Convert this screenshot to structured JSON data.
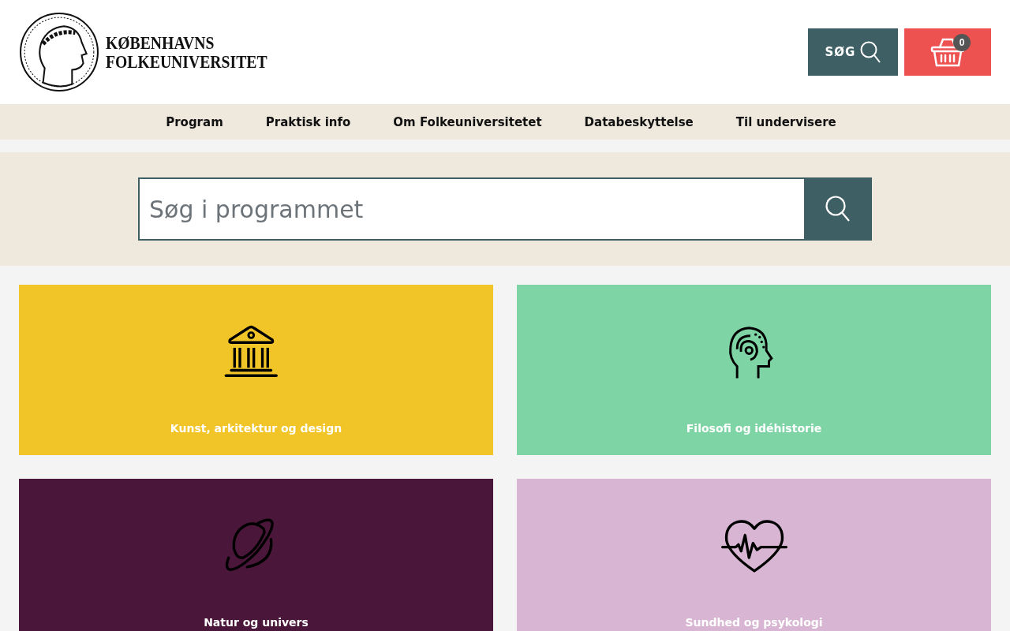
{
  "logo": {
    "line_1": "KØBENHAVNS",
    "line_2": "FOLKEUNIVERSITET"
  },
  "search_button": {
    "label": "SØG"
  },
  "cart": {
    "count": "0"
  },
  "nav": [
    {
      "label": "Program"
    },
    {
      "label": "Praktisk info"
    },
    {
      "label": "Om Folkeuniversitetet"
    },
    {
      "label": "Databeskyttelse"
    },
    {
      "label": "Til undervisere"
    }
  ],
  "search": {
    "placeholder": "Søg i programmet"
  },
  "categories": [
    {
      "title": "Kunst, arkitektur og design",
      "kind": "building",
      "color": "#f1c427"
    },
    {
      "title": "Filosofi og idéhistorie",
      "kind": "head",
      "color": "#7fd4a6"
    },
    {
      "title": "Natur og univers",
      "kind": "planet",
      "color": "#4a173b"
    },
    {
      "title": "Sundhed og psykologi",
      "kind": "heart",
      "color": "#d8b6d3"
    }
  ]
}
